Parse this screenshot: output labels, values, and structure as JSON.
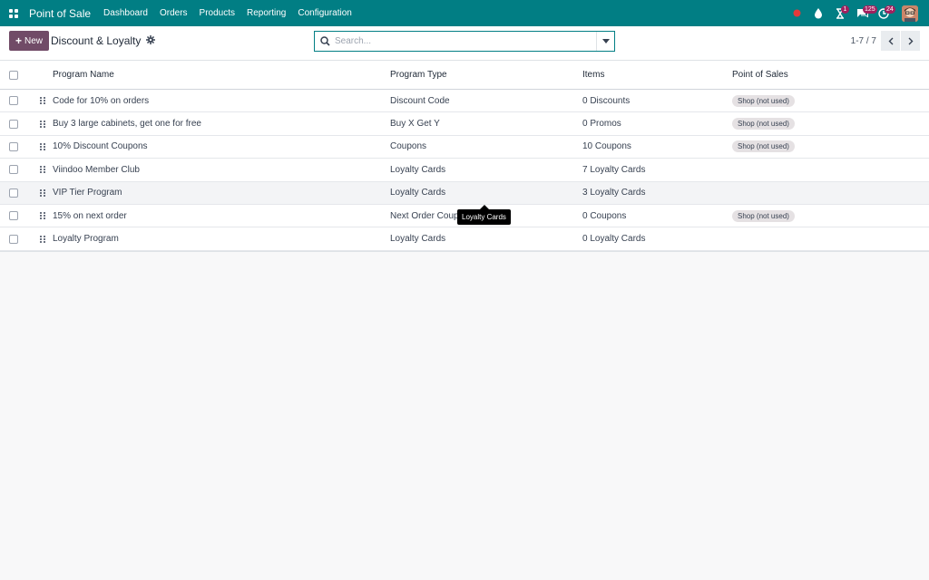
{
  "navbar": {
    "app_title": "Point of Sale",
    "menu": [
      "Dashboard",
      "Orders",
      "Products",
      "Reporting",
      "Configuration"
    ],
    "badges": {
      "activity": "1",
      "messages": "125",
      "clock": "24"
    }
  },
  "control": {
    "new_label": "New",
    "title": "Discount & Loyalty",
    "search_placeholder": "Search...",
    "pager": "1-7 / 7"
  },
  "table": {
    "headers": [
      "Program Name",
      "Program Type",
      "Items",
      "Point of Sales"
    ],
    "rows": [
      {
        "name": "Code for 10% on orders",
        "type": "Discount Code",
        "items": "0 Discounts",
        "pos": "Shop (not used)"
      },
      {
        "name": "Buy 3 large cabinets, get one for free",
        "type": "Buy X Get Y",
        "items": "0 Promos",
        "pos": "Shop (not used)"
      },
      {
        "name": "10% Discount Coupons",
        "type": "Coupons",
        "items": "10 Coupons",
        "pos": "Shop (not used)"
      },
      {
        "name": "Viindoo Member Club",
        "type": "Loyalty Cards",
        "items": "7 Loyalty Cards",
        "pos": ""
      },
      {
        "name": "VIP Tier Program",
        "type": "Loyalty Cards",
        "items": "3 Loyalty Cards",
        "pos": ""
      },
      {
        "name": "15% on next order",
        "type": "Next Order Coupons",
        "items": "0 Coupons",
        "pos": "Shop (not used)"
      },
      {
        "name": "Loyalty Program",
        "type": "Loyalty Cards",
        "items": "0 Loyalty Cards",
        "pos": ""
      }
    ]
  },
  "tooltip": "Loyalty Cards",
  "colors": {
    "navbar": "#017e84",
    "primary_button": "#714b67",
    "badge": "#a1205e",
    "status_dot": "#e23a3a"
  }
}
